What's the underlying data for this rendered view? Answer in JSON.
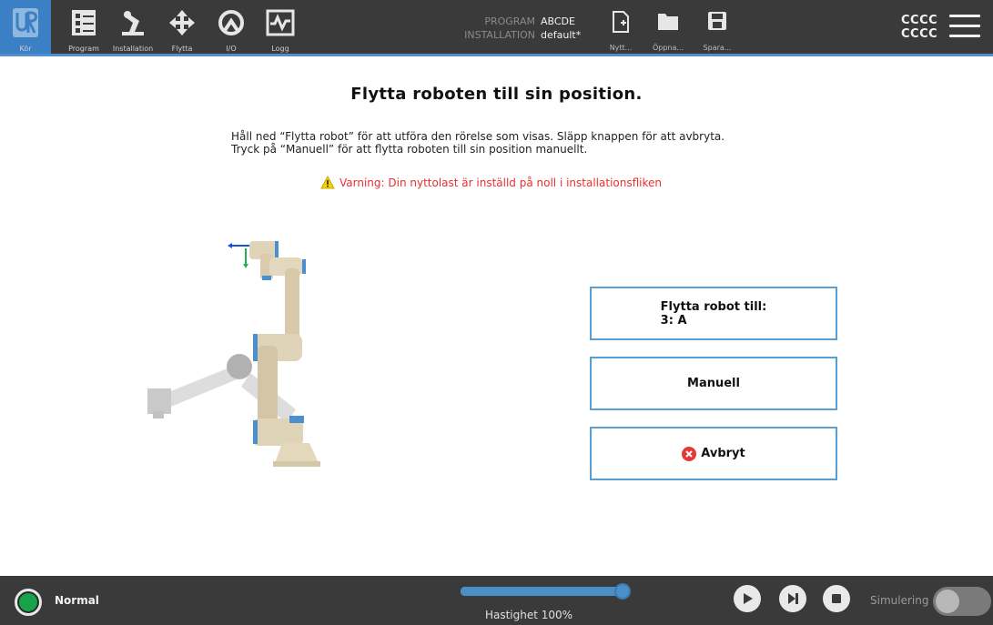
{
  "nav": {
    "tabs": [
      {
        "label": "Kör",
        "icon": "ur-logo-icon",
        "active": true
      },
      {
        "label": "Program",
        "icon": "program-icon",
        "active": false
      },
      {
        "label": "Installation",
        "icon": "installation-icon",
        "active": false
      },
      {
        "label": "Flytta",
        "icon": "move-arrows-icon",
        "active": false
      },
      {
        "label": "I/O",
        "icon": "io-icon",
        "active": false
      },
      {
        "label": "Logg",
        "icon": "log-icon",
        "active": false
      }
    ]
  },
  "program_info": {
    "program_key": "PROGRAM",
    "program_value": "ABCDE",
    "installation_key": "INSTALLATION",
    "installation_value": "default*"
  },
  "file_buttons": {
    "new_label": "Nytt...",
    "open_label": "Öppna...",
    "save_label": "Spara..."
  },
  "user": {
    "line1": "CCCC",
    "line2": "CCCC"
  },
  "main": {
    "title": "Flytta roboten till sin position.",
    "desc_line1": "Håll ned “Flytta robot” för att utföra den rörelse som visas. Släpp knappen för att avbryta.",
    "desc_line2": "Tryck på “Manuell” för att flytta roboten till sin position manuellt.",
    "warning": "Varning: Din nyttolast är inställd på noll i installationsfliken"
  },
  "actions": {
    "move_line1": "Flytta robot till:",
    "move_line2": "3: A",
    "manual_label": "Manuell",
    "abort_label": "Avbryt"
  },
  "footer": {
    "status_text": "Normal",
    "speed_label": "Hastighet 100%",
    "speed_percent": 100,
    "simulation_label": "Simulering",
    "simulation_on": false
  },
  "colors": {
    "accent": "#3b7fc4",
    "bar": "#3a3a3a",
    "warning": "#e8302f",
    "status_ok": "#16a34a"
  }
}
